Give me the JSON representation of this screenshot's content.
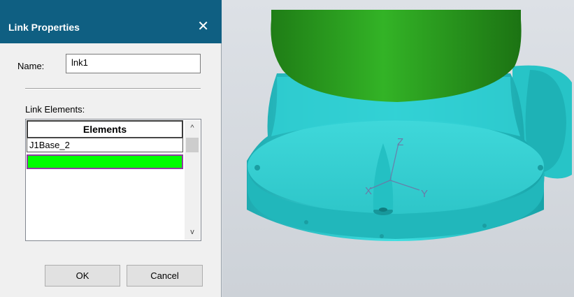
{
  "dialog": {
    "title": "Link Properties",
    "close_glyph": "✕",
    "name_label": "Name:",
    "name_value": "lnk1",
    "link_elements_label": "Link Elements:",
    "table": {
      "header": "Elements",
      "rows": [
        "J1Base_2",
        ""
      ]
    },
    "scroll_up_glyph": "^",
    "scroll_down_glyph": "v",
    "ok_label": "OK",
    "cancel_label": "Cancel"
  },
  "viewport": {
    "axis_x": "X",
    "axis_y": "Y",
    "axis_z": "Z",
    "colors": {
      "body_green": "#2b9a1f",
      "base_cyan": "#2ad0d4",
      "selection_green": "#00ff00",
      "selection_border": "#8f3ca2",
      "titlebar": "#0f5f82"
    }
  }
}
